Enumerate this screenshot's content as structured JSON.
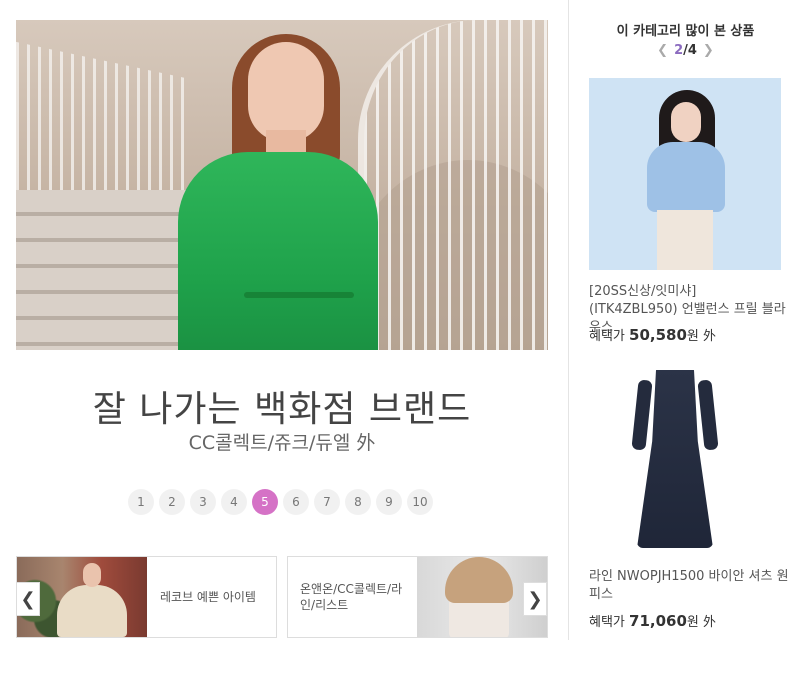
{
  "promo": {
    "title": "잘 나가는 백화점 브랜드",
    "subtitle": "CC콜렉트/쥬크/듀엘 外",
    "pages": [
      "1",
      "2",
      "3",
      "4",
      "5",
      "6",
      "7",
      "8",
      "9",
      "10"
    ],
    "active_page": "5",
    "prev_arrow": "❮",
    "next_arrow": "❯",
    "thumbs": [
      {
        "label": "레코브 예쁜 아이템"
      },
      {
        "label": "온앤온/CC콜렉트/라인/리스트"
      }
    ]
  },
  "sidebar": {
    "title": "이 카테고리 많이 본 상품",
    "pager": {
      "current": "2",
      "separator": "/",
      "total": "4",
      "prev": "❮",
      "next": "❯"
    },
    "products": [
      {
        "name": "[20SS신상/잇미샤] (ITK4ZBL950) 언밸런스 프릴 블라우스",
        "price_label": "혜택가",
        "price": "50,580",
        "unit": "원 外"
      },
      {
        "name": "라인 NWOPJH1500 바이안 셔츠 원피스",
        "price_label": "혜택가",
        "price": "71,060",
        "unit": "원 外"
      }
    ]
  }
}
